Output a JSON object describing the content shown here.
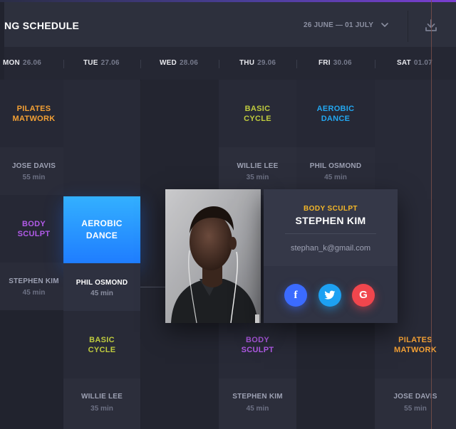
{
  "header": {
    "title": "NG SCHEDULE",
    "date_range": "26 JUNE — 01 JULY"
  },
  "days": [
    {
      "name": "MON",
      "date": "26.06"
    },
    {
      "name": "TUE",
      "date": "27.06"
    },
    {
      "name": "WED",
      "date": "28.06"
    },
    {
      "name": "THU",
      "date": "29.06"
    },
    {
      "name": "FRI",
      "date": "30.06"
    },
    {
      "name": "SAT",
      "date": "01.07"
    }
  ],
  "classes": {
    "mon_1": {
      "title1": "PILATES",
      "title2": "MATWORK",
      "trainer": "JOSE DAVIS",
      "duration": "55 min"
    },
    "mon_2": {
      "title1": "BODY",
      "title2": "SCULPT",
      "trainer": "STEPHEN KIM",
      "duration": "45 min"
    },
    "thu_1": {
      "title1": "BASIC",
      "title2": "CYCLE",
      "trainer": "WILLIE LEE",
      "duration": "35 min"
    },
    "fri_1": {
      "title1": "AEROBIC",
      "title2": "DANCE",
      "trainer": "PHIL OSMOND",
      "duration": "45 min"
    },
    "tue_sel": {
      "title1": "AEROBIC",
      "title2": "DANCE",
      "trainer": "PHIL OSMOND",
      "duration": "45 min"
    },
    "tue_3": {
      "title1": "BASIC",
      "title2": "CYCLE",
      "trainer": "WILLIE LEE",
      "duration": "35 min"
    },
    "thu_3": {
      "title1": "BODY",
      "title2": "SCULPT",
      "trainer": "STEPHEN KIM",
      "duration": "45 min"
    },
    "sat_3": {
      "title1": "PILATES",
      "title2": "MATWORK",
      "trainer": "JOSE DAVIS",
      "duration": "55 min"
    }
  },
  "trainer_card": {
    "class_name": "BODY SCULPT",
    "name": "STEPHEN KIM",
    "email": "stephan_k@gmail.com",
    "social": {
      "facebook": "f",
      "twitter": "twitter-bird",
      "google": "G"
    }
  },
  "colors": {
    "pilates": "#f4a135",
    "cycle": "#bfcb3e",
    "aerobic": "#23a7f0",
    "sculpt": "#b25be8",
    "selected": "#1f7dff"
  }
}
